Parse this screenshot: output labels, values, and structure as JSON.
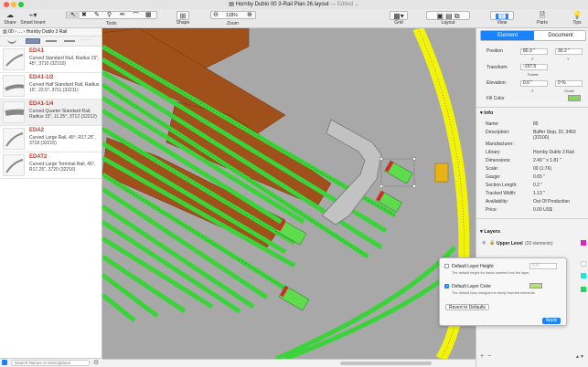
{
  "window": {
    "title": "Hornby Dublo 00 3-Rail Plan 26.layout",
    "edited": "— Edited ⌄"
  },
  "toolbar": {
    "share": "Share",
    "smart_insert": "Smart Insert",
    "tools": "Tools",
    "shape": "Shape",
    "zoom": "Zoom",
    "zoom_value": "128%",
    "grid": "Grid",
    "layout": "Layout",
    "view": "View",
    "parts": "Parts",
    "tips": "Tips"
  },
  "library": {
    "breadcrumb": "Hornby Dublo 3 Rail",
    "crumb_root": "00",
    "items": [
      {
        "code": "EDA1",
        "desc": "Curved Standard Rail, Radius 15\", 45°, 3710 (32210)"
      },
      {
        "code": "EDA1-1/2",
        "desc": "Curved Half Standard Rail, Radius 15\", 22.5°, 3711 (32211)"
      },
      {
        "code": "EDA1-1/4",
        "desc": "Curved Quarter Standard Rail, Radius 15\", 11.25°, 3712 (32212)"
      },
      {
        "code": "EDA2",
        "desc": "Curved Large Rail, 45°, R17.25\", 3718 (32215)"
      },
      {
        "code": "EDAT2",
        "desc": "Curved Large Terminal Rail, 45°, R17.25\", 3720 (32216)"
      }
    ],
    "search_placeholder": "Search Names or Descriptions"
  },
  "inspector": {
    "tab_element": "Element",
    "tab_document": "Document",
    "position_label": "Position",
    "position_x": "80.3 \"",
    "position_y": "30.2 \"",
    "x": "X",
    "y": "Y",
    "transform_label": "Transform",
    "transform_value": "-157.5",
    "rotate": "Rotate",
    "elevation_label": "Elevation:",
    "elevation_value": "0.0 \"",
    "grade_value": "0 %",
    "z": "Z",
    "grade": "Grade",
    "fill_label": "Fill Color",
    "fill_color": "#7ed957",
    "info_title": "Info",
    "info": [
      {
        "k": "Name:",
        "v": "85"
      },
      {
        "k": "Description:",
        "v": "Buffer Stop, DI, 3450 (32100)"
      },
      {
        "k": "Manufacturer:",
        "v": ""
      },
      {
        "k": "Library:",
        "v": "Hornby Dublo 3 Rail"
      },
      {
        "k": "Dimensions:",
        "v": "2.49 \" x 1.81 \""
      },
      {
        "k": "Scale:",
        "v": "00 (1:76)"
      },
      {
        "k": "Gauge:",
        "v": "0.65 \""
      },
      {
        "k": "Section Length:",
        "v": "0.2 \""
      },
      {
        "k": "Tracked Width:",
        "v": "1.13 \""
      },
      {
        "k": "Availability:",
        "v": "Out Of Production"
      },
      {
        "k": "Price:",
        "v": "0.00 US$"
      }
    ],
    "layers_title": "Layers",
    "layer_name": "Upper Level",
    "layer_count": "(20 elements)"
  },
  "popover": {
    "height_label": "Default Layer Height",
    "height_value": "0.0 \"",
    "height_help": "The default height for tracks inserted into the layer.",
    "color_label": "Default Layer Color",
    "color_value": "#b5e07a",
    "color_help": "The default color assigned to newly inserted elements.",
    "revert": "Revert to Defaults",
    "apply": "Apply"
  },
  "colors": {
    "accent": "#1a82fb",
    "track": "#3ad43a",
    "board": "#a0501a",
    "selection": "#c0c0c0"
  }
}
